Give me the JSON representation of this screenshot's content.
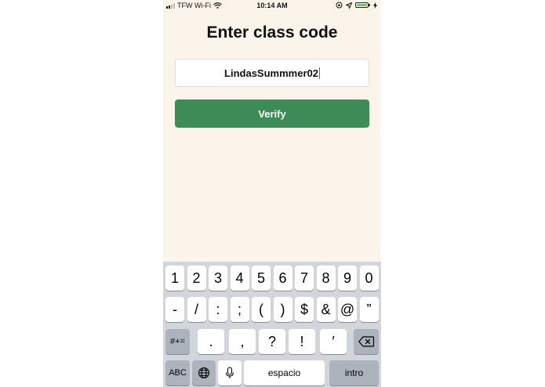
{
  "status_bar": {
    "carrier": "TFW Wi-Fi",
    "time": "10:14 AM"
  },
  "title": "Enter class code",
  "code_input": {
    "value": "LindasSummmer02"
  },
  "verify_button": {
    "label": "Verify"
  },
  "keyboard": {
    "row1": [
      "1",
      "2",
      "3",
      "4",
      "5",
      "6",
      "7",
      "8",
      "9",
      "0"
    ],
    "row2": [
      "-",
      "/",
      ":",
      ";",
      "(",
      ")",
      "$",
      "&",
      "@",
      "”"
    ],
    "row3": {
      "more_symbols": "#+=",
      "keys": [
        ".",
        ",",
        "?",
        "!",
        "′"
      ]
    },
    "row4": {
      "abc": "ABC",
      "space": "espacio",
      "return": "intro"
    }
  },
  "colors": {
    "background": "#faf4ea",
    "accent": "#3d8c58"
  }
}
